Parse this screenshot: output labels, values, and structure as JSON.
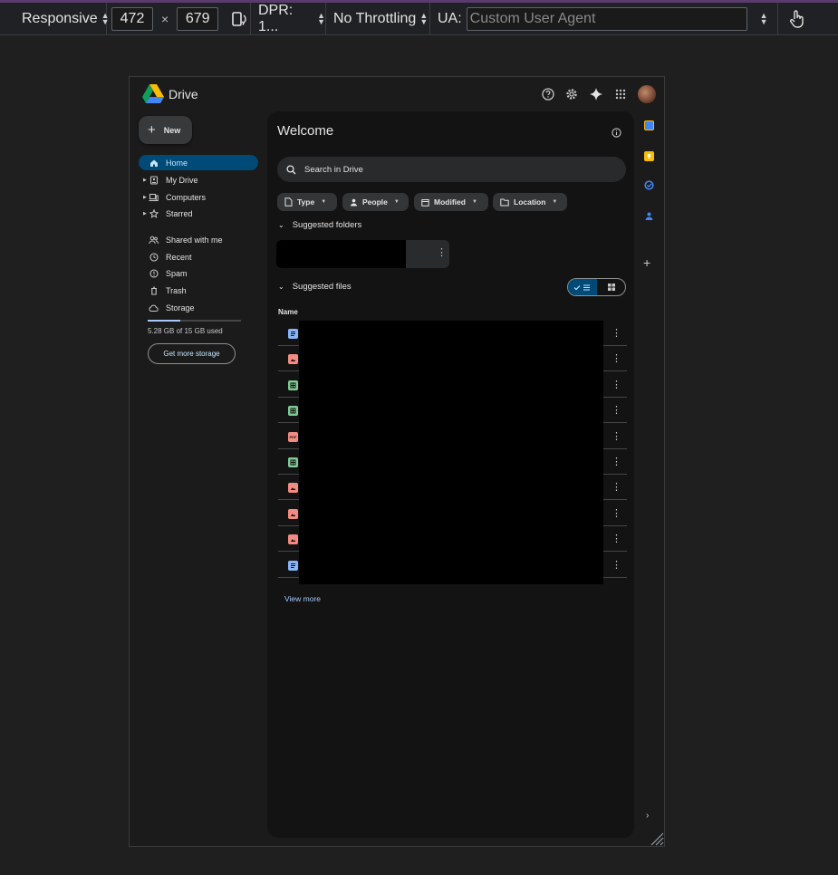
{
  "devtools": {
    "device": "Responsive",
    "width": "472",
    "times": "×",
    "height": "679",
    "dpr": "DPR: 1...",
    "throttling": "No Throttling",
    "ua_label": "UA:",
    "ua_placeholder": "Custom User Agent"
  },
  "app": {
    "brand": "Drive",
    "new_label": "New"
  },
  "sidebar": {
    "items": [
      {
        "label": "Home",
        "active": true
      },
      {
        "label": "My Drive"
      },
      {
        "label": "Computers"
      },
      {
        "label": "Starred"
      },
      {
        "label": "Shared with me"
      },
      {
        "label": "Recent"
      },
      {
        "label": "Spam"
      },
      {
        "label": "Trash"
      },
      {
        "label": "Storage"
      }
    ],
    "storage_used_fraction": 0.35,
    "storage_text": "5.28 GB of 15 GB used",
    "storage_button": "Get more storage"
  },
  "main": {
    "title": "Welcome",
    "search_placeholder": "Search in Drive",
    "chips": [
      "Type",
      "People",
      "Modified",
      "Location"
    ],
    "suggested_folders": "Suggested folders",
    "suggested_files": "Suggested files",
    "name_header": "Name",
    "file_types": [
      "doc",
      "image",
      "sheet",
      "sheet",
      "pdf",
      "sheet",
      "image",
      "image",
      "image",
      "doc"
    ],
    "pdf_label": "PDF",
    "view_more": "View more"
  },
  "colors": {
    "accent": "#004a77",
    "doc": "#8ab4f8",
    "image": "#f28b82",
    "sheet": "#81c995",
    "pdf": "#f28b82"
  }
}
